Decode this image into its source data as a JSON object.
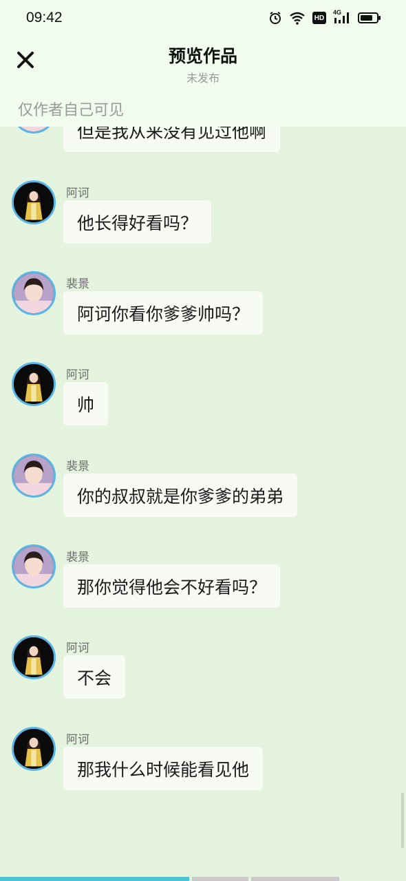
{
  "status_bar": {
    "time": "09:42",
    "icons": [
      "alarm-icon",
      "wifi-icon",
      "hd-icon",
      "signal-4g-icon",
      "battery-icon"
    ],
    "hd_text": "HD",
    "net_text": "4G"
  },
  "header": {
    "title": "预览作品",
    "subtitle": "未发布",
    "close_icon": "close-icon",
    "visibility_note": "仅作者自己可见"
  },
  "messages": [
    {
      "sender": "",
      "avatar": "peijing",
      "text": "但是我从来没有见过他啊"
    },
    {
      "sender": "阿诃",
      "avatar": "ahe",
      "text": "他长得好看吗？"
    },
    {
      "sender": "裴景",
      "avatar": "peijing",
      "text": "阿诃你看你爹爹帅吗？"
    },
    {
      "sender": "阿诃",
      "avatar": "ahe",
      "text": "帅"
    },
    {
      "sender": "裴景",
      "avatar": "peijing",
      "text": "你的叔叔就是你爹爹的弟弟"
    },
    {
      "sender": "裴景",
      "avatar": "peijing",
      "text": "那你觉得他会不好看吗？"
    },
    {
      "sender": "阿诃",
      "avatar": "ahe",
      "text": "不会"
    },
    {
      "sender": "阿诃",
      "avatar": "ahe",
      "text": "那我什么时候能看见他"
    }
  ],
  "colors": {
    "background": "#e3f3dd",
    "header_bg": "#f1fbee",
    "bubble_bg": "#f7fbf4",
    "avatar_ring": "#5bb6e6",
    "progress_played": "#4cc3d2",
    "progress_rest": "#c9c9c9"
  }
}
